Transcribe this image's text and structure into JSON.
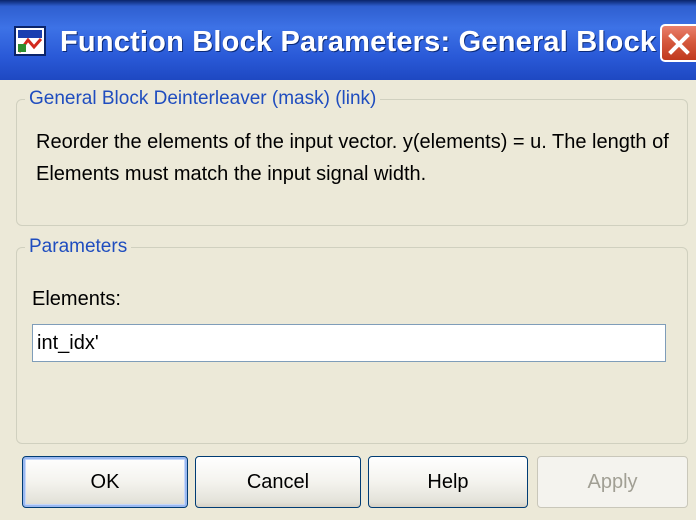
{
  "window": {
    "title": "Function Block Parameters: General Block D...",
    "app_icon": "simulink-block-icon",
    "close_icon": "close-icon"
  },
  "description_group": {
    "legend": "General Block Deinterleaver (mask) (link)",
    "text": "Reorder the elements of the input vector. y(elements) = u.  The length of Elements must match the input signal width."
  },
  "parameters_group": {
    "legend": "Parameters",
    "elements_label": "Elements:",
    "elements_value": "int_idx'"
  },
  "buttons": {
    "ok": "OK",
    "cancel": "Cancel",
    "help": "Help",
    "apply": "Apply"
  },
  "colors": {
    "titlebar": "#2a5ad8",
    "legend": "#1f4dbf",
    "close": "#d65a3e",
    "dialog_bg": "#ece9d8"
  }
}
